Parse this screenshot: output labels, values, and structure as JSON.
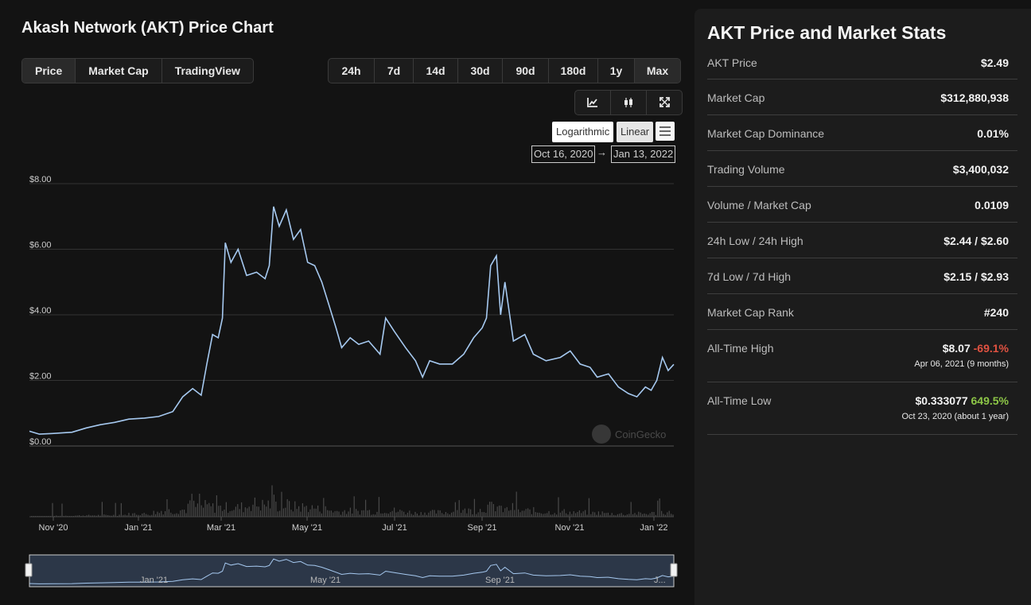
{
  "header": {
    "title": "Akash Network (AKT) Price Chart"
  },
  "tabs": [
    "Price",
    "Market Cap",
    "TradingView"
  ],
  "ranges": [
    "24h",
    "7d",
    "14d",
    "30d",
    "90d",
    "180d",
    "1y",
    "Max"
  ],
  "icons": [
    "line-chart-icon",
    "candlestick-icon",
    "fullscreen-icon"
  ],
  "scale": {
    "log": "Logarithmic",
    "linear": "Linear"
  },
  "date_range": {
    "from": "Oct 16, 2020",
    "arrow": "→",
    "to": "Jan 13, 2022"
  },
  "watermark": "CoinGecko",
  "colors": {
    "line": "#a6c9f0",
    "navigator_fill": "#2c3748",
    "volume": "#4a4a4a",
    "negative": "#e15241",
    "positive": "#8dc647"
  },
  "chart_data": {
    "type": "line",
    "title": "Akash Network (AKT) Price Chart",
    "y_ticks": [
      "$0.00",
      "$2.00",
      "$4.00",
      "$6.00",
      "$8.00"
    ],
    "x_ticks": [
      "Nov '20",
      "Jan '21",
      "Mar '21",
      "May '21",
      "Jul '21",
      "Sep '21",
      "Nov '21",
      "Jan '22"
    ],
    "navigator_ticks": [
      "Jan '21",
      "May '21",
      "Sep '21",
      "J..."
    ],
    "ylim": [
      0,
      8
    ],
    "xlim": [
      "2020-10-16",
      "2022-01-13"
    ],
    "grid": true,
    "series": [
      {
        "values": [
          {
            "x": "2020-10-16",
            "y": 0.45
          },
          {
            "x": "2020-10-23",
            "y": 0.36
          },
          {
            "x": "2020-11-01",
            "y": 0.38
          },
          {
            "x": "2020-11-15",
            "y": 0.42
          },
          {
            "x": "2020-11-25",
            "y": 0.55
          },
          {
            "x": "2020-12-05",
            "y": 0.65
          },
          {
            "x": "2020-12-15",
            "y": 0.72
          },
          {
            "x": "2020-12-25",
            "y": 0.82
          },
          {
            "x": "2021-01-05",
            "y": 0.85
          },
          {
            "x": "2021-01-15",
            "y": 0.9
          },
          {
            "x": "2021-01-25",
            "y": 1.05
          },
          {
            "x": "2021-02-01",
            "y": 1.5
          },
          {
            "x": "2021-02-08",
            "y": 1.75
          },
          {
            "x": "2021-02-14",
            "y": 1.55
          },
          {
            "x": "2021-02-18",
            "y": 2.5
          },
          {
            "x": "2021-02-22",
            "y": 3.4
          },
          {
            "x": "2021-02-26",
            "y": 3.3
          },
          {
            "x": "2021-03-01",
            "y": 3.9
          },
          {
            "x": "2021-03-03",
            "y": 6.2
          },
          {
            "x": "2021-03-07",
            "y": 5.6
          },
          {
            "x": "2021-03-12",
            "y": 6.0
          },
          {
            "x": "2021-03-18",
            "y": 5.2
          },
          {
            "x": "2021-03-25",
            "y": 5.3
          },
          {
            "x": "2021-03-31",
            "y": 5.1
          },
          {
            "x": "2021-04-03",
            "y": 5.5
          },
          {
            "x": "2021-04-06",
            "y": 7.3
          },
          {
            "x": "2021-04-10",
            "y": 6.7
          },
          {
            "x": "2021-04-15",
            "y": 7.2
          },
          {
            "x": "2021-04-20",
            "y": 6.3
          },
          {
            "x": "2021-04-25",
            "y": 6.6
          },
          {
            "x": "2021-04-30",
            "y": 5.6
          },
          {
            "x": "2021-05-05",
            "y": 5.5
          },
          {
            "x": "2021-05-10",
            "y": 5.0
          },
          {
            "x": "2021-05-15",
            "y": 4.3
          },
          {
            "x": "2021-05-20",
            "y": 3.6
          },
          {
            "x": "2021-05-24",
            "y": 3.0
          },
          {
            "x": "2021-05-30",
            "y": 3.3
          },
          {
            "x": "2021-06-05",
            "y": 3.1
          },
          {
            "x": "2021-06-12",
            "y": 3.2
          },
          {
            "x": "2021-06-20",
            "y": 2.8
          },
          {
            "x": "2021-06-24",
            "y": 3.9
          },
          {
            "x": "2021-06-30",
            "y": 3.5
          },
          {
            "x": "2021-07-08",
            "y": 3.0
          },
          {
            "x": "2021-07-15",
            "y": 2.6
          },
          {
            "x": "2021-07-20",
            "y": 2.1
          },
          {
            "x": "2021-07-25",
            "y": 2.6
          },
          {
            "x": "2021-08-01",
            "y": 2.5
          },
          {
            "x": "2021-08-10",
            "y": 2.5
          },
          {
            "x": "2021-08-18",
            "y": 2.8
          },
          {
            "x": "2021-08-25",
            "y": 3.3
          },
          {
            "x": "2021-08-31",
            "y": 3.6
          },
          {
            "x": "2021-09-03",
            "y": 3.9
          },
          {
            "x": "2021-09-06",
            "y": 5.5
          },
          {
            "x": "2021-09-10",
            "y": 5.8
          },
          {
            "x": "2021-09-13",
            "y": 4.0
          },
          {
            "x": "2021-09-16",
            "y": 5.0
          },
          {
            "x": "2021-09-22",
            "y": 3.2
          },
          {
            "x": "2021-09-30",
            "y": 3.4
          },
          {
            "x": "2021-10-06",
            "y": 2.8
          },
          {
            "x": "2021-10-15",
            "y": 2.6
          },
          {
            "x": "2021-10-25",
            "y": 2.7
          },
          {
            "x": "2021-11-01",
            "y": 2.9
          },
          {
            "x": "2021-11-08",
            "y": 2.5
          },
          {
            "x": "2021-11-15",
            "y": 2.4
          },
          {
            "x": "2021-11-20",
            "y": 2.1
          },
          {
            "x": "2021-11-28",
            "y": 2.2
          },
          {
            "x": "2021-12-05",
            "y": 1.8
          },
          {
            "x": "2021-12-12",
            "y": 1.6
          },
          {
            "x": "2021-12-18",
            "y": 1.5
          },
          {
            "x": "2021-12-24",
            "y": 1.8
          },
          {
            "x": "2021-12-28",
            "y": 1.7
          },
          {
            "x": "2022-01-01",
            "y": 2.0
          },
          {
            "x": "2022-01-05",
            "y": 2.7
          },
          {
            "x": "2022-01-09",
            "y": 2.3
          },
          {
            "x": "2022-01-13",
            "y": 2.49
          }
        ]
      }
    ]
  },
  "stats": {
    "title": "AKT Price and Market Stats",
    "rows": [
      {
        "label": "AKT Price",
        "value": "$2.49"
      },
      {
        "label": "Market Cap",
        "value": "$312,880,938"
      },
      {
        "label": "Market Cap Dominance",
        "value": "0.01%"
      },
      {
        "label": "Trading Volume",
        "value": "$3,400,032"
      },
      {
        "label": "Volume / Market Cap",
        "value": "0.0109"
      },
      {
        "label": "24h Low / 24h High",
        "value": "$2.44 / $2.60"
      },
      {
        "label": "7d Low / 7d High",
        "value": "$2.15 / $2.93"
      },
      {
        "label": "Market Cap Rank",
        "value": "#240"
      }
    ],
    "ath": {
      "label": "All-Time High",
      "value": "$8.07",
      "change": "-69.1%",
      "date": "Apr 06, 2021 (9 months)"
    },
    "atl": {
      "label": "All-Time Low",
      "value": "$0.333077",
      "change": "649.5%",
      "date": "Oct 23, 2020 (about 1 year)"
    }
  }
}
